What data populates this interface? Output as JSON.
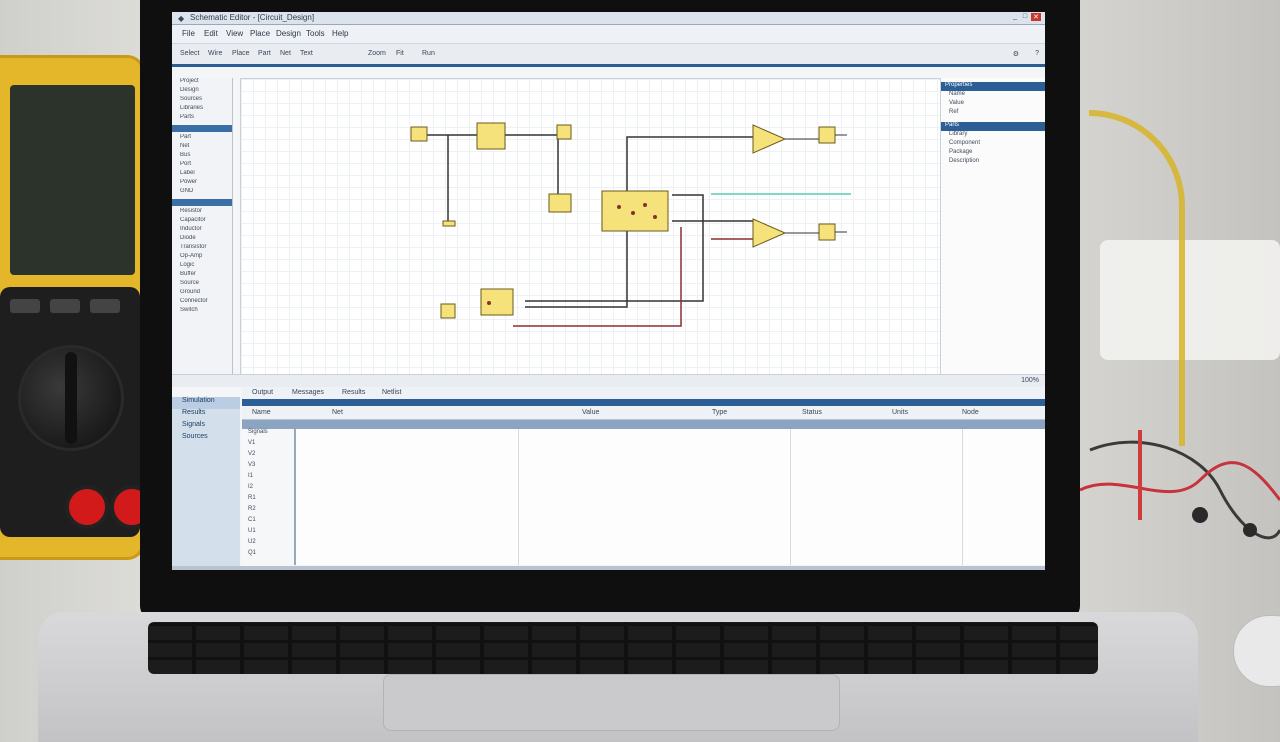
{
  "window": {
    "title": "Schematic Editor - [Circuit_Design]",
    "controls": [
      "_",
      "□",
      "✕"
    ]
  },
  "menubar": {
    "items": [
      "File",
      "Edit",
      "View",
      "Place",
      "Design",
      "Tools",
      "Help"
    ]
  },
  "toolbar": {
    "items": [
      "Select",
      "Wire",
      "Place",
      "Part",
      "Net",
      "Text",
      "Zoom",
      "Fit",
      "Run"
    ]
  },
  "left_panel": {
    "section1": [
      "Project",
      "Design",
      "Sources",
      "Libraries",
      "Parts"
    ],
    "section2": [
      "Part",
      "Net",
      "Bus",
      "Port",
      "Label",
      "Power",
      "GND"
    ],
    "section3": [
      "Resistor",
      "Capacitor",
      "Inductor",
      "Diode",
      "Transistor",
      "Op-Amp",
      "Logic",
      "Buffer",
      "Source",
      "Ground",
      "Connector",
      "Switch"
    ]
  },
  "right_panel": {
    "header": "Properties",
    "header2": "Parts",
    "items": [
      "Name",
      "Value",
      "Ref"
    ],
    "items2": [
      "Library",
      "Component",
      "Package",
      "Description"
    ]
  },
  "status": {
    "zoom": "100%"
  },
  "bottom": {
    "tabs": [
      "Output",
      "Messages",
      "Results",
      "Netlist"
    ],
    "nav": [
      "Simulation",
      "Results",
      "Signals",
      "Sources"
    ],
    "columns": [
      "Name",
      "Net",
      "Value",
      "Type",
      "Status",
      "Units",
      "Node"
    ],
    "tree": [
      "Signals",
      "V1",
      "V2",
      "V3",
      "I1",
      "I2",
      "R1",
      "R2",
      "C1",
      "U1",
      "U2",
      "Q1"
    ]
  },
  "colors": {
    "accent": "#2b5f96",
    "component_fill": "#f6e27a",
    "wire_dark": "#333333",
    "wire_red": "#8c2f2f",
    "selection": "#7fd9c4"
  }
}
